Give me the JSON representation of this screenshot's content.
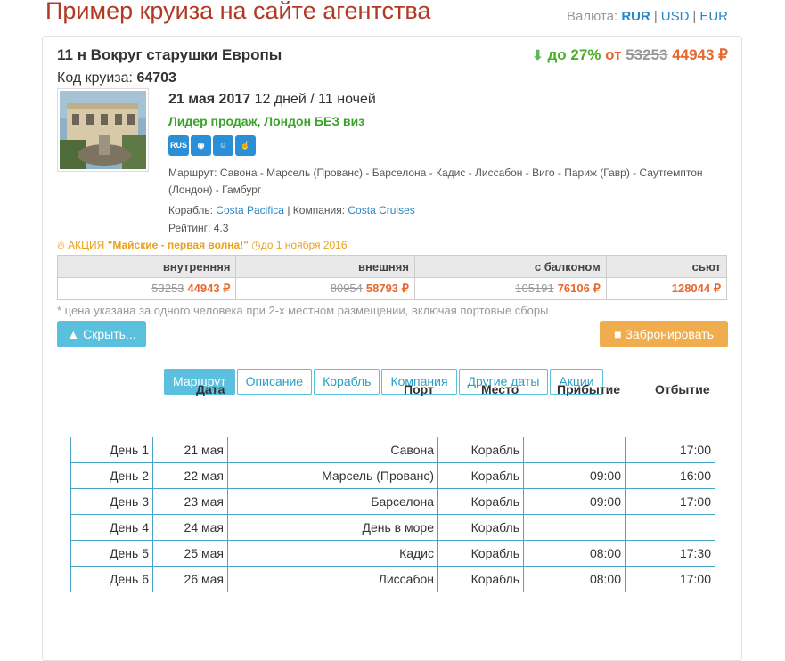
{
  "header": {
    "title": "Пример круиза на сайте агентства",
    "currency_label": "Валюта:",
    "currencies": [
      "RUR",
      "USD",
      "EUR"
    ]
  },
  "cruise": {
    "title": "11 н Вокруг старушки Европы",
    "discount": "до 27%",
    "from_label": "от",
    "old_price": "53253",
    "new_price": "44943 ₽",
    "code_label": "Код круиза:",
    "code": "64703",
    "date": "21 мая 2017",
    "duration": "12 дней / 11 ночей",
    "leader": "Лидер продаж, Лондон БЕЗ виз",
    "feature_icons": [
      "rus-language-icon",
      "piggy-bank-icon",
      "family-icon",
      "thumbs-up-icon"
    ],
    "route_label": "Маршрут:",
    "route": "Савона - Марсель (Прованс) - Барселона - Кадис - Лиссабон - Виго - Париж (Гавр) - Саутгемптон (Лондон) - Гамбург",
    "ship_label": "Корабль:",
    "ship": "Costa Pacifica",
    "company_label": "Компания:",
    "company": "Costa Cruises",
    "rating_label": "Рейтинг:",
    "rating": "4.3",
    "promo_prefix": "АКЦИЯ",
    "promo_name": "\"Майские - первая волна!\"",
    "promo_until": "до 1 ноября 2016"
  },
  "cabins": [
    {
      "name": "внутренняя",
      "old": "53253",
      "new": "44943 ₽"
    },
    {
      "name": "внешняя",
      "old": "80954",
      "new": "58793 ₽"
    },
    {
      "name": "с балконом",
      "old": "105191",
      "new": "76106 ₽"
    },
    {
      "name": "сьют",
      "old": "",
      "new": "128044 ₽"
    }
  ],
  "note": "* цена указана за одного человека при 2-х местном размещении, включая портовые сборы",
  "buttons": {
    "hide": "Скрыть...",
    "book": "Забронировать"
  },
  "tabs": [
    "Маршрут",
    "Описание",
    "Корабль",
    "Компания",
    "Другие даты",
    "Акции"
  ],
  "schedule": {
    "headers": {
      "date": "Дата",
      "port": "Порт",
      "place": "Место",
      "arrival": "Прибытие",
      "departure": "Отбытие"
    },
    "rows": [
      {
        "day": "День 1",
        "date": "21 мая",
        "port": "Савона",
        "place": "Корабль",
        "arrival": "",
        "departure": "17:00"
      },
      {
        "day": "День 2",
        "date": "22 мая",
        "port": "Марсель (Прованс)",
        "place": "Корабль",
        "arrival": "09:00",
        "departure": "16:00"
      },
      {
        "day": "День 3",
        "date": "23 мая",
        "port": "Барселона",
        "place": "Корабль",
        "arrival": "09:00",
        "departure": "17:00"
      },
      {
        "day": "День 4",
        "date": "24 мая",
        "port": "День в море",
        "place": "Корабль",
        "arrival": "",
        "departure": ""
      },
      {
        "day": "День 5",
        "date": "25 мая",
        "port": "Кадис",
        "place": "Корабль",
        "arrival": "08:00",
        "departure": "17:30"
      },
      {
        "day": "День 6",
        "date": "26 мая",
        "port": "Лиссабон",
        "place": "Корабль",
        "arrival": "08:00",
        "departure": "17:00"
      }
    ]
  },
  "colors": {
    "brand_title": "#b23a25",
    "price_orange": "#e8672e",
    "discount_green": "#4cae2b",
    "info_blue": "#5bc0de",
    "warning_orange": "#f0ad4e"
  }
}
